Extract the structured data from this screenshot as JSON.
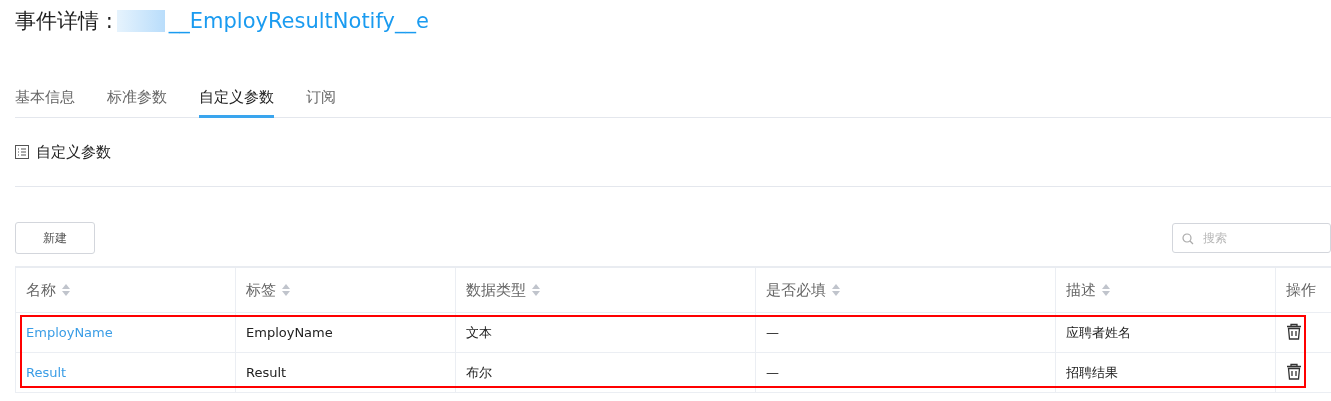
{
  "header": {
    "title": "事件详情 :",
    "event_name": "__EmployResultNotify__e"
  },
  "tabs": [
    {
      "label": "基本信息",
      "selected": false
    },
    {
      "label": "标准参数",
      "selected": false
    },
    {
      "label": "自定义参数",
      "selected": true
    },
    {
      "label": "订阅",
      "selected": false
    }
  ],
  "section": {
    "title": "自定义参数"
  },
  "toolbar": {
    "new_button": "新建",
    "search": {
      "placeholder": "搜索"
    }
  },
  "table": {
    "columns": [
      {
        "label": "名称",
        "sortable": true
      },
      {
        "label": "标签",
        "sortable": true
      },
      {
        "label": "数据类型",
        "sortable": true
      },
      {
        "label": "是否必填",
        "sortable": true
      },
      {
        "label": "描述",
        "sortable": true
      },
      {
        "label": "操作",
        "sortable": false
      }
    ],
    "rows": [
      {
        "name": "EmployName",
        "label": "EmployName",
        "type": "文本",
        "required": "—",
        "description": "应聘者姓名"
      },
      {
        "name": "Result",
        "label": "Result",
        "type": "布尔",
        "required": "—",
        "description": "招聘结果"
      }
    ]
  }
}
